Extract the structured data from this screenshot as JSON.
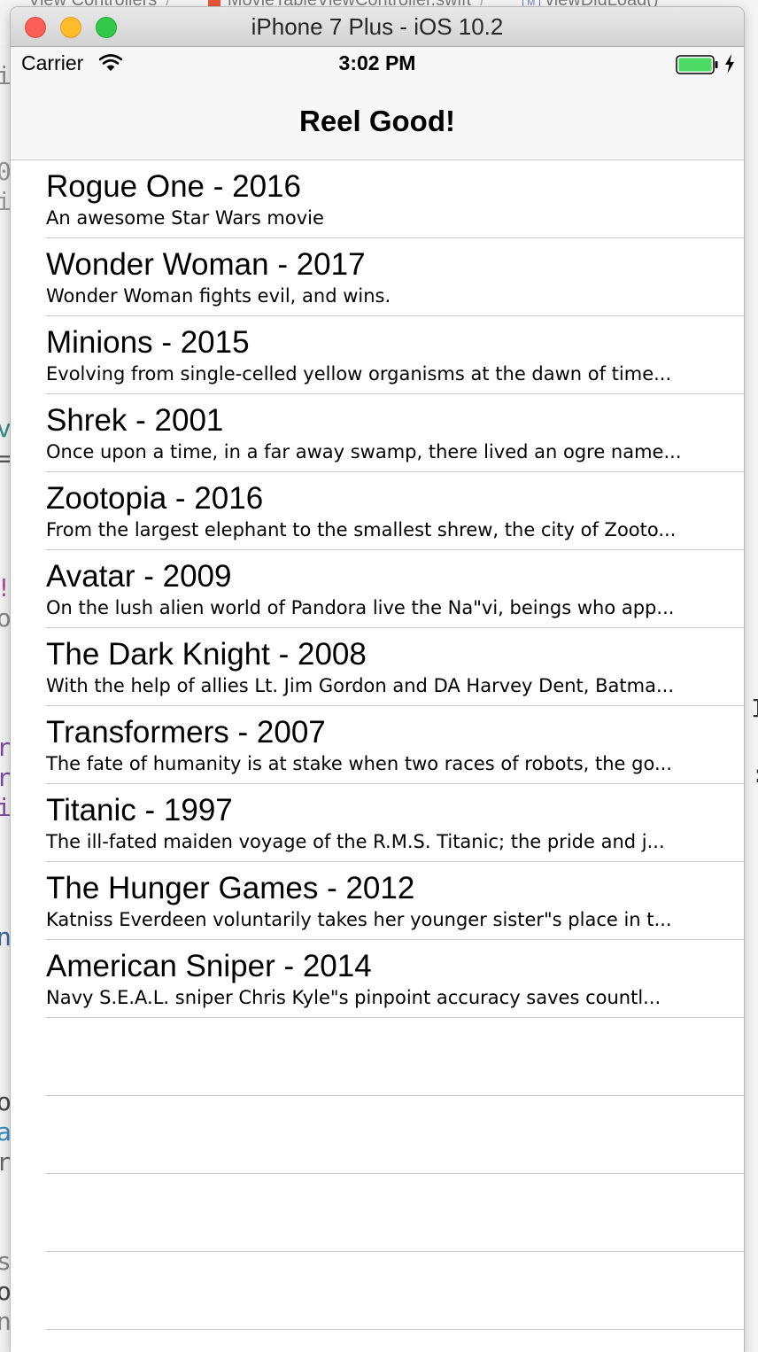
{
  "background": {
    "breadcrumb": [
      "View Controllers",
      "MovieTableViewController.swift",
      "viewDidLoad()"
    ]
  },
  "window": {
    "title": "iPhone 7 Plus - iOS 10.2",
    "buttons": [
      "close",
      "minimize",
      "zoom"
    ]
  },
  "status_bar": {
    "carrier": "Carrier",
    "time": "3:02 PM",
    "icons": [
      "wifi-icon",
      "battery-icon",
      "charging-bolt-icon"
    ],
    "battery_color": "#4cd964"
  },
  "nav_bar": {
    "title": "Reel Good!"
  },
  "movies": [
    {
      "title": "Rogue One - 2016",
      "subtitle": "An awesome Star Wars movie"
    },
    {
      "title": "Wonder Woman - 2017",
      "subtitle": "Wonder Woman fights evil, and wins."
    },
    {
      "title": "Minions - 2015",
      "subtitle": "Evolving from single-celled yellow organisms at the dawn of time..."
    },
    {
      "title": "Shrek - 2001",
      "subtitle": "Once upon a time, in a far away swamp, there lived an ogre name..."
    },
    {
      "title": "Zootopia - 2016",
      "subtitle": "From the largest elephant to the smallest shrew, the city of Zooto..."
    },
    {
      "title": "Avatar - 2009",
      "subtitle": "On the lush alien world of Pandora live the Na\"vi, beings who app..."
    },
    {
      "title": "The Dark Knight - 2008",
      "subtitle": "With the help of allies Lt. Jim Gordon and DA Harvey Dent, Batma..."
    },
    {
      "title": "Transformers - 2007",
      "subtitle": "The fate of humanity is at stake when two races of robots, the go..."
    },
    {
      "title": "Titanic - 1997",
      "subtitle": "The ill-fated maiden voyage of the R.M.S. Titanic; the pride and j..."
    },
    {
      "title": "The Hunger Games - 2012",
      "subtitle": "Katniss Everdeen voluntarily takes her younger sister\"s place in t..."
    },
    {
      "title": "American Sniper - 2014",
      "subtitle": "Navy S.E.A.L. sniper Chris Kyle\"s pinpoint accuracy saves countl..."
    }
  ],
  "empty_rows": 4
}
